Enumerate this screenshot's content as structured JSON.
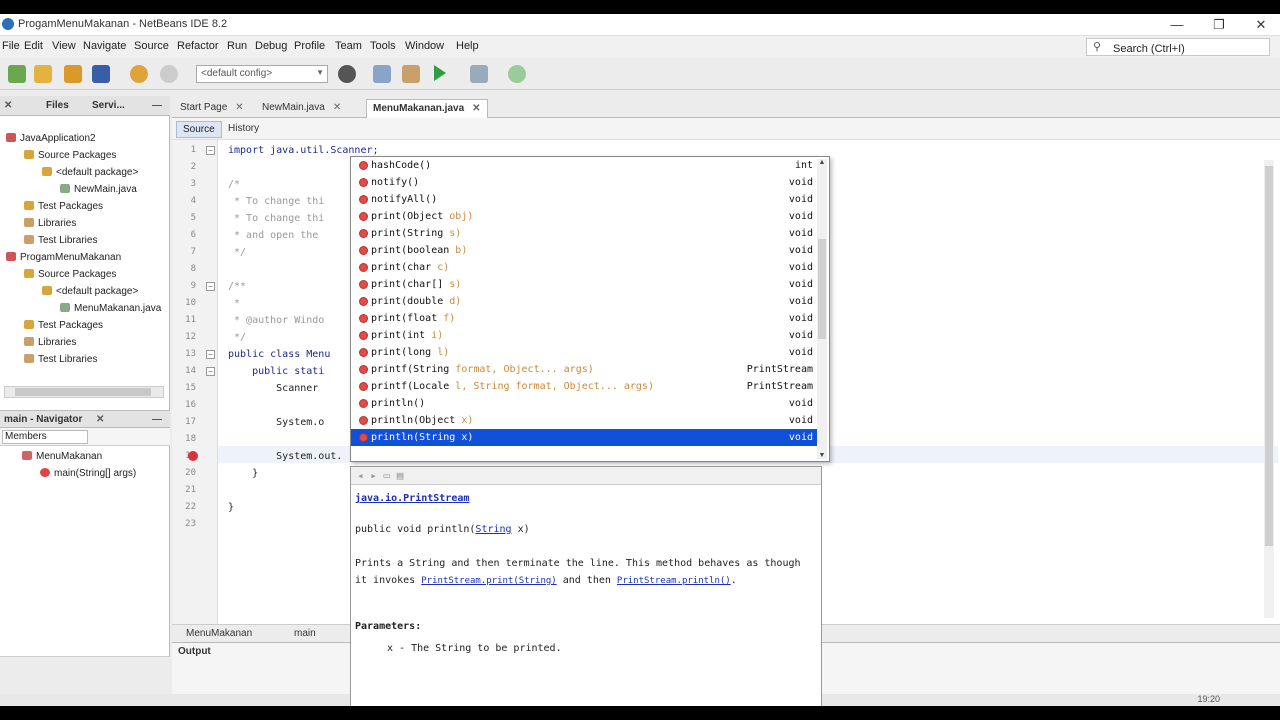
{
  "window": {
    "title": "ProgamMenuMakanan - NetBeans IDE 8.2",
    "minimize": "—",
    "maximize": "❐",
    "close": "✕"
  },
  "menu": [
    "File",
    "Edit",
    "View",
    "Navigate",
    "Source",
    "Refactor",
    "Run",
    "Debug",
    "Profile",
    "Team",
    "Tools",
    "Window",
    "Help"
  ],
  "search": {
    "placeholder": "Search (Ctrl+I)"
  },
  "toolbar": {
    "config": "<default config>"
  },
  "projects": {
    "tabs": [
      "Files",
      "Servi..."
    ],
    "tree": [
      {
        "label": "JavaApplication2",
        "level": 0,
        "icon": "project-icon"
      },
      {
        "label": "Source Packages",
        "level": 1,
        "icon": "package-folder-icon"
      },
      {
        "label": "<default package>",
        "level": 2,
        "icon": "package-icon"
      },
      {
        "label": "NewMain.java",
        "level": 3,
        "icon": "java-file-icon"
      },
      {
        "label": "Test Packages",
        "level": 1,
        "icon": "package-folder-icon"
      },
      {
        "label": "Libraries",
        "level": 1,
        "icon": "library-icon"
      },
      {
        "label": "Test Libraries",
        "level": 1,
        "icon": "library-icon"
      },
      {
        "label": "ProgamMenuMakanan",
        "level": 0,
        "icon": "project-icon"
      },
      {
        "label": "Source Packages",
        "level": 1,
        "icon": "package-folder-icon"
      },
      {
        "label": "<default package>",
        "level": 2,
        "icon": "package-icon"
      },
      {
        "label": "MenuMakanan.java",
        "level": 3,
        "icon": "java-file-icon"
      },
      {
        "label": "Test Packages",
        "level": 1,
        "icon": "package-folder-icon"
      },
      {
        "label": "Libraries",
        "level": 1,
        "icon": "library-icon"
      },
      {
        "label": "Test Libraries",
        "level": 1,
        "icon": "library-icon"
      }
    ]
  },
  "navigator": {
    "title": "main - Navigator",
    "filter": "Members",
    "class": "MenuMakanan",
    "method": "main(String[] args)"
  },
  "editor": {
    "tabs": [
      "Start Page",
      "NewMain.java",
      "MenuMakanan.java"
    ],
    "source_label": "Source",
    "history_label": "History",
    "lines": [
      {
        "n": "1",
        "text": "import java.util.Scanner;"
      },
      {
        "n": "2",
        "text": ""
      },
      {
        "n": "3",
        "text": "/*"
      },
      {
        "n": "4",
        "text": " * To change thi"
      },
      {
        "n": "5",
        "text": " * To change thi"
      },
      {
        "n": "6",
        "text": " * and open the"
      },
      {
        "n": "7",
        "text": " */"
      },
      {
        "n": "8",
        "text": ""
      },
      {
        "n": "9",
        "text": "/**"
      },
      {
        "n": "10",
        "text": " *"
      },
      {
        "n": "11",
        "text": " * @author Windo"
      },
      {
        "n": "12",
        "text": " */"
      },
      {
        "n": "13",
        "text": "public class Menu"
      },
      {
        "n": "14",
        "text": "    public stati"
      },
      {
        "n": "15",
        "text": "        Scanner"
      },
      {
        "n": "16",
        "text": ""
      },
      {
        "n": "17",
        "text": "        System.o"
      },
      {
        "n": "18",
        "text": ""
      },
      {
        "n": "19",
        "text": "        System.out."
      },
      {
        "n": "20",
        "text": "    }"
      },
      {
        "n": "21",
        "text": ""
      },
      {
        "n": "22",
        "text": "}"
      },
      {
        "n": "23",
        "text": ""
      }
    ]
  },
  "completion": {
    "items": [
      {
        "name": "hashCode()",
        "params": "",
        "ret": "int"
      },
      {
        "name": "notify()",
        "params": "",
        "ret": "void"
      },
      {
        "name": "notifyAll()",
        "params": "",
        "ret": "void"
      },
      {
        "name": "print(Object ",
        "params": "obj)",
        "ret": "void"
      },
      {
        "name": "print(String ",
        "params": "s)",
        "ret": "void"
      },
      {
        "name": "print(boolean ",
        "params": "b)",
        "ret": "void"
      },
      {
        "name": "print(char ",
        "params": "c)",
        "ret": "void"
      },
      {
        "name": "print(char[] ",
        "params": "s)",
        "ret": "void"
      },
      {
        "name": "print(double ",
        "params": "d)",
        "ret": "void"
      },
      {
        "name": "print(float ",
        "params": "f)",
        "ret": "void"
      },
      {
        "name": "print(int ",
        "params": "i)",
        "ret": "void"
      },
      {
        "name": "print(long ",
        "params": "l)",
        "ret": "void"
      },
      {
        "name": "printf(String ",
        "params": "format, Object... args)",
        "ret": "PrintStream"
      },
      {
        "name": "printf(Locale ",
        "params": "l, String format, Object... args)",
        "ret": "PrintStream"
      },
      {
        "name": "println()",
        "params": "",
        "ret": "void"
      },
      {
        "name": "println(Object ",
        "params": "x)",
        "ret": "void"
      },
      {
        "name": "println(String ",
        "params": "x)",
        "ret": "void"
      }
    ],
    "selected_index": 16
  },
  "javadoc": {
    "package": "java.io.PrintStream",
    "sig_prefix": "public void println(",
    "sig_type": "String",
    "sig_suffix": " x)",
    "desc1": "Prints a String and then terminate the line. This method behaves as though it invokes ",
    "link1": "PrintStream.print(String)",
    "desc2": " and then ",
    "link2": "PrintStream.println()",
    "desc3": ".",
    "params_label": "Parameters:",
    "param": "x - The String to be printed."
  },
  "crumbs": [
    "MenuMakanan",
    "main"
  ],
  "output": {
    "label": "Output"
  },
  "status": {
    "pos": "19:20"
  }
}
